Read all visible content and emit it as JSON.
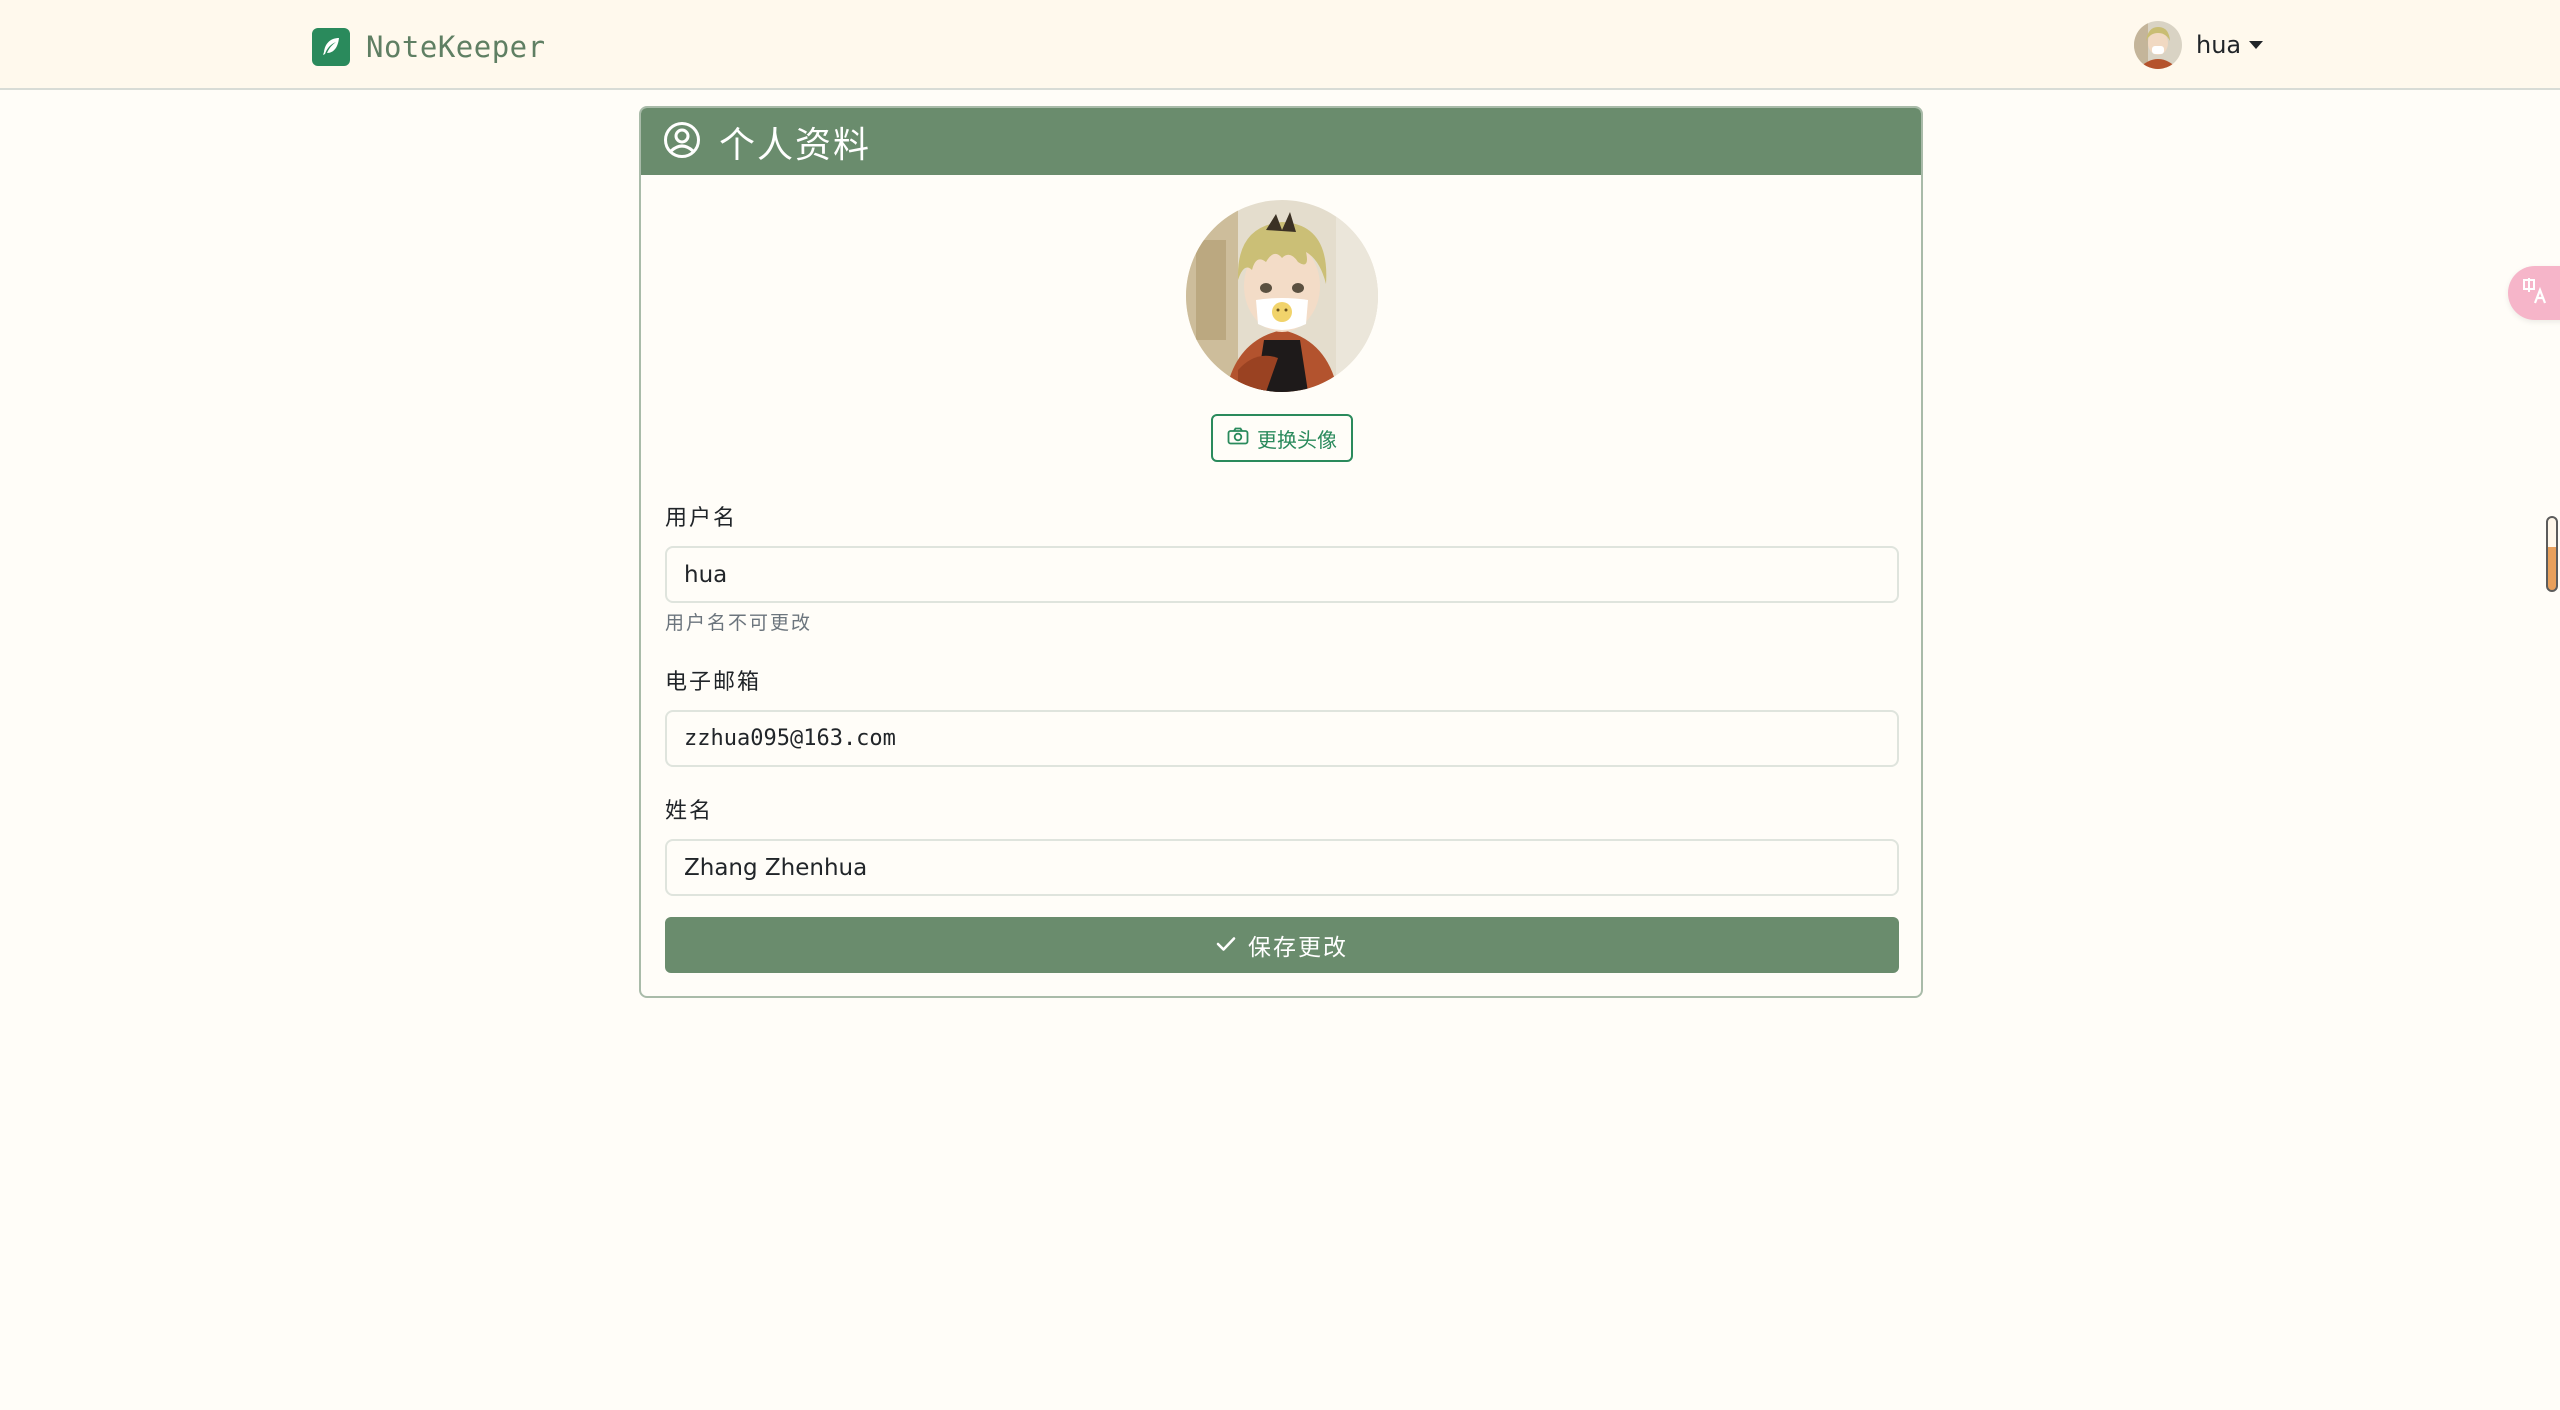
{
  "navbar": {
    "brand": "NoteKeeper",
    "brand_icon": "feather-icon",
    "user_name": "hua"
  },
  "profile_card": {
    "title": "个人资料",
    "title_icon": "user-circle-icon",
    "change_avatar_label": "更换头像",
    "fields": {
      "username": {
        "label": "用户名",
        "value": "hua",
        "help": "用户名不可更改"
      },
      "email": {
        "label": "电子邮箱",
        "value": "zzhua095@163.com"
      },
      "full_name": {
        "label": "姓名",
        "value": "Zhang Zhenhua"
      }
    },
    "save_label": "保存更改"
  },
  "colors": {
    "primary": "#6a8c6d",
    "brand_green": "#2a8a5c",
    "navbar_bg": "#fff9ed",
    "page_bg": "#fffdf8"
  }
}
